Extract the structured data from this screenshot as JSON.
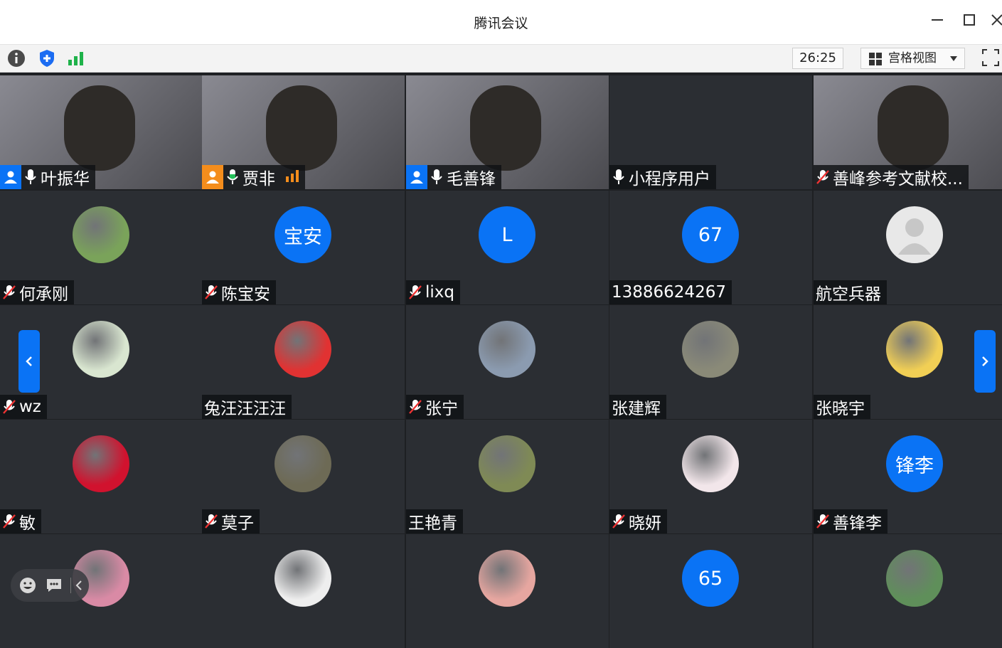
{
  "window": {
    "title": "腾讯会议"
  },
  "toolbar": {
    "timer": "26:25",
    "view_label": "宫格视图"
  },
  "colors": {
    "accent": "#0a73f5",
    "host_badge": "#f48d1c",
    "active_border": "#24c05a"
  },
  "rows": [
    [
      {
        "name": "叶振华",
        "kind": "video",
        "role": "blue",
        "mic": "on"
      },
      {
        "name": "贾非",
        "kind": "video",
        "role": "orange",
        "mic": "active",
        "signal": true,
        "active": true
      },
      {
        "name": "毛善锋",
        "kind": "video",
        "role": "blue",
        "mic": "on"
      },
      {
        "name": "小程序用户",
        "kind": "blank",
        "mic": "on"
      },
      {
        "name": "善峰参考文献校...",
        "kind": "video",
        "mic": "muted"
      }
    ],
    [
      {
        "name": "何承刚",
        "kind": "photo",
        "avatar_color": "#7aa35a",
        "mic": "muted"
      },
      {
        "name": "陈宝安",
        "kind": "text",
        "avatar_text": "宝安",
        "mic": "muted"
      },
      {
        "name": "lixq",
        "kind": "text",
        "avatar_text": "L",
        "mic": "muted"
      },
      {
        "name": "13886624267",
        "kind": "text",
        "avatar_text": "67",
        "mic": "none"
      },
      {
        "name": "航空兵器",
        "kind": "default",
        "mic": "none"
      }
    ],
    [
      {
        "name": "wz",
        "kind": "photo",
        "avatar_color": "#d9e6d0",
        "mic": "muted"
      },
      {
        "name": "兔汪汪汪汪",
        "kind": "photo",
        "avatar_color": "#e13232",
        "mic": "none"
      },
      {
        "name": "张宁",
        "kind": "photo",
        "avatar_color": "#8b9bb0",
        "mic": "muted"
      },
      {
        "name": "张建辉",
        "kind": "photo",
        "avatar_color": "#8a8a78",
        "mic": "none"
      },
      {
        "name": "张晓宇",
        "kind": "photo",
        "avatar_color": "#f1cf55",
        "mic": "none"
      }
    ],
    [
      {
        "name": "敏",
        "kind": "photo",
        "avatar_color": "#d1122e",
        "mic": "muted"
      },
      {
        "name": "莫子",
        "kind": "photo",
        "avatar_color": "#6d6a55",
        "mic": "muted"
      },
      {
        "name": "王艳青",
        "kind": "photo",
        "avatar_color": "#7f8a55",
        "mic": "none"
      },
      {
        "name": "晓妍",
        "kind": "photo",
        "avatar_color": "#f2e6ea",
        "mic": "muted"
      },
      {
        "name": "善锋李",
        "kind": "text",
        "avatar_text": "锋李",
        "mic": "muted"
      }
    ],
    [
      {
        "name": "",
        "kind": "photo",
        "avatar_color": "#d98aa5"
      },
      {
        "name": "",
        "kind": "photo",
        "avatar_color": "#eeeeee"
      },
      {
        "name": "",
        "kind": "photo",
        "avatar_color": "#e6a6a0"
      },
      {
        "name": "",
        "kind": "text",
        "avatar_text": "65"
      },
      {
        "name": "",
        "kind": "photo",
        "avatar_color": "#5f8f5a"
      }
    ]
  ]
}
